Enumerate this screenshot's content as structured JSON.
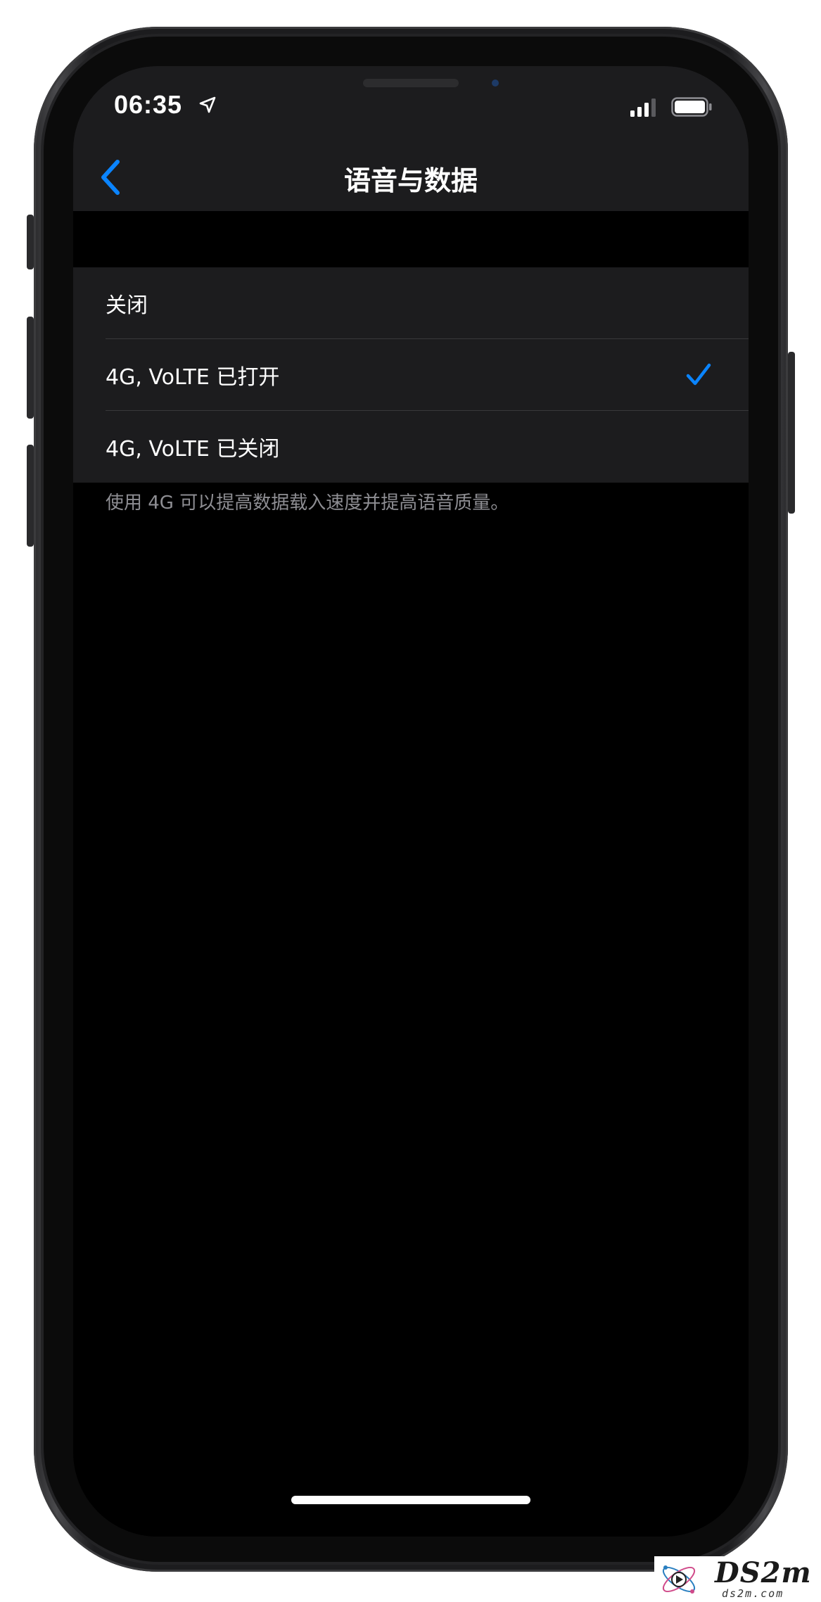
{
  "status_bar": {
    "time": "06:35",
    "icons": [
      "location-arrow-icon",
      "cellular-signal-icon",
      "battery-icon"
    ]
  },
  "nav": {
    "back_icon": "chevron-left-icon",
    "title": "语音与数据"
  },
  "options": [
    {
      "label": "关闭",
      "selected": false
    },
    {
      "label": "4G, VoLTE 已打开",
      "selected": true
    },
    {
      "label": "4G, VoLTE 已关闭",
      "selected": false
    }
  ],
  "footer_note": "使用 4G 可以提高数据载入速度并提高语音质量。",
  "colors": {
    "accent": "#0a84ff",
    "background": "#000000",
    "grouped_row": "#1c1c1e",
    "secondary_text": "#8e8e93"
  },
  "watermark": {
    "title": "DS2m",
    "sub": "ds2m.com"
  }
}
